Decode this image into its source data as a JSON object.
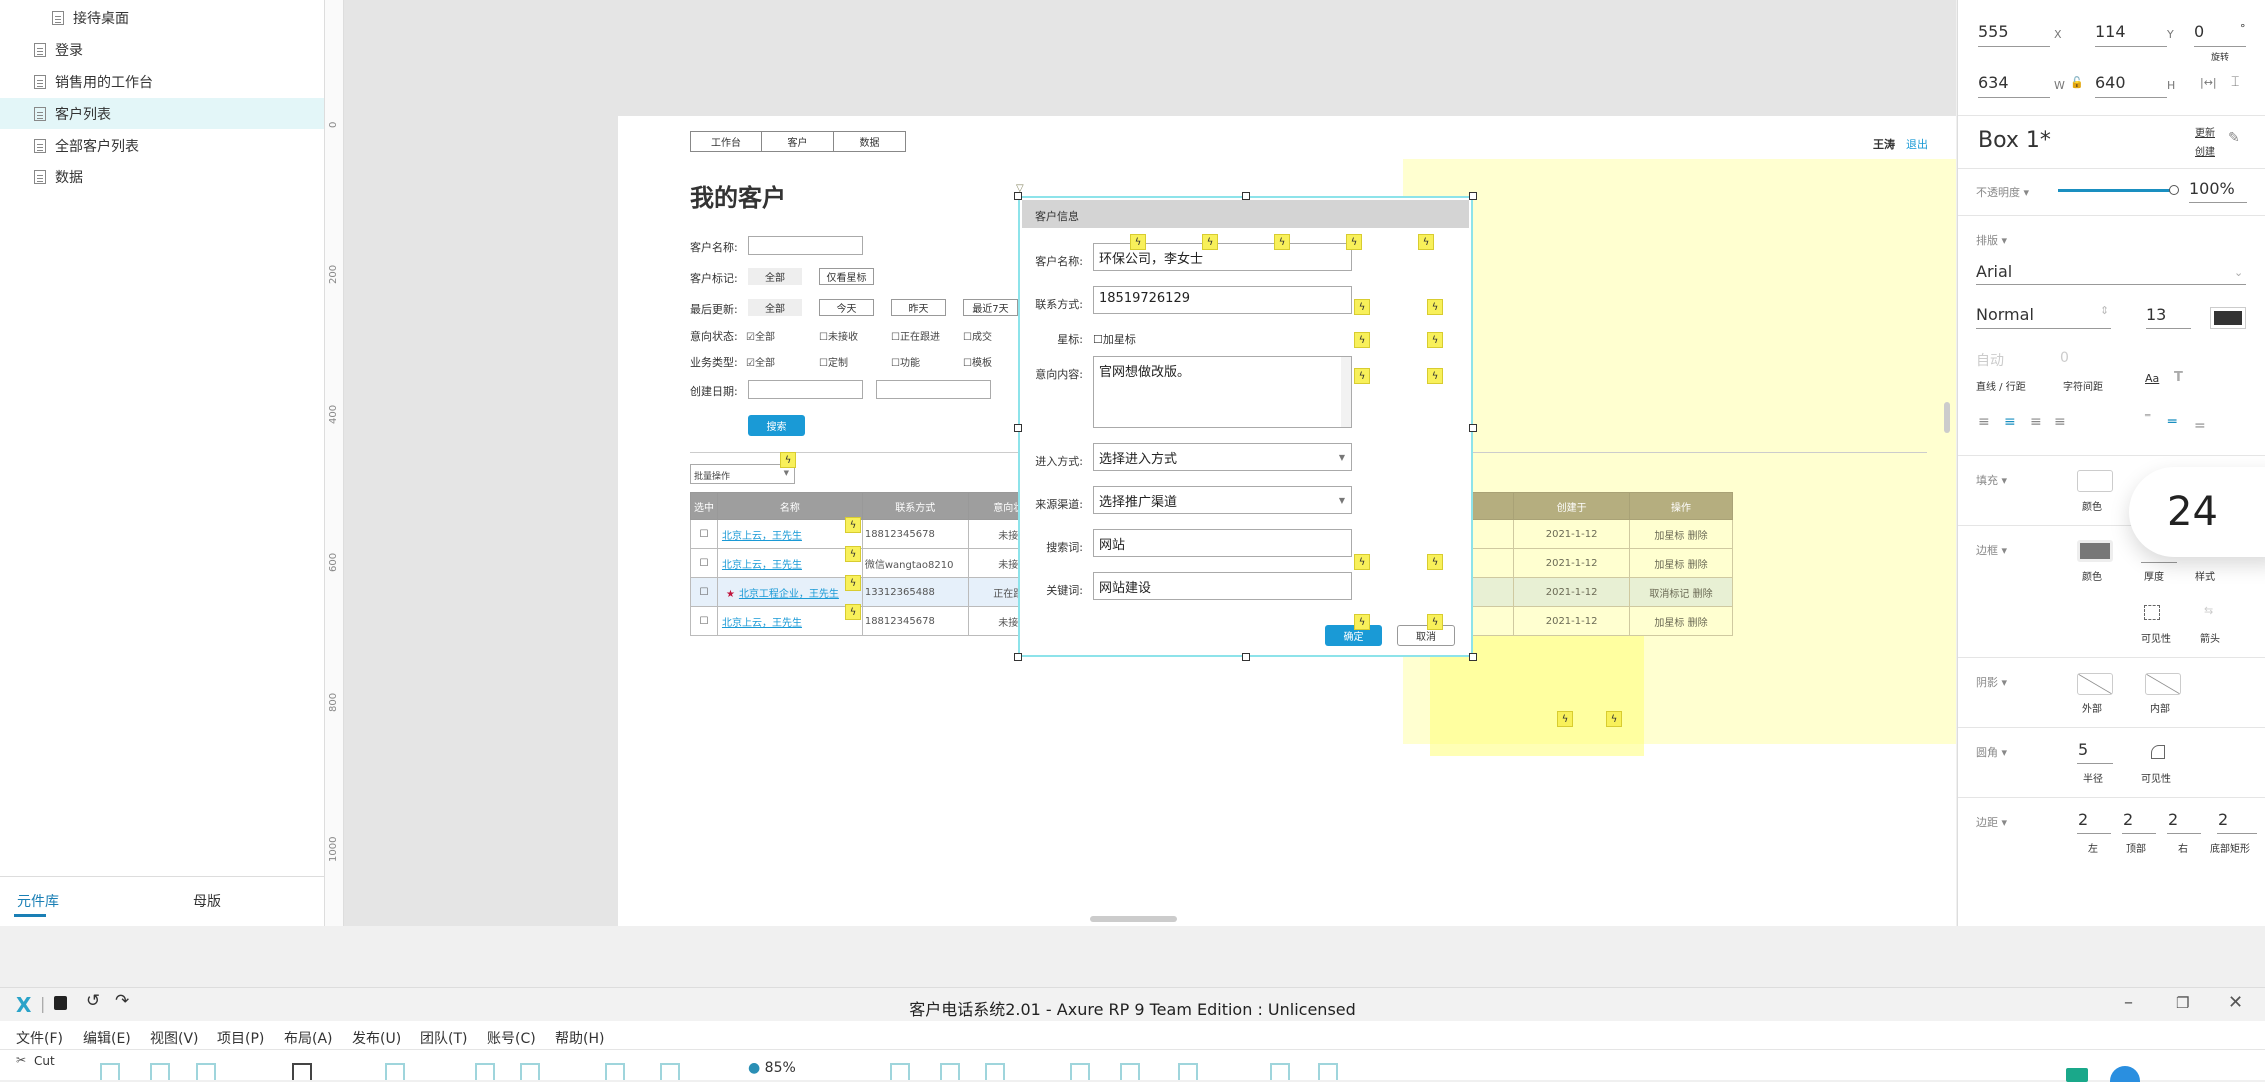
{
  "sidebar": {
    "items": [
      {
        "label": "接待桌面"
      },
      {
        "label": "登录"
      },
      {
        "label": "销售用的工作台"
      },
      {
        "label": "客户列表",
        "active": true
      },
      {
        "label": "全部客户列表"
      },
      {
        "label": "数据"
      }
    ],
    "tabs": [
      {
        "label": "元件库",
        "active": true
      },
      {
        "label": "母版"
      }
    ]
  },
  "ruler": {
    "ticks": [
      "0",
      "200",
      "400",
      "600",
      "800",
      "1000"
    ]
  },
  "proto": {
    "nav": [
      "工作台",
      "客户",
      "数据"
    ],
    "user": "王涛",
    "logout": "退出",
    "title": "我的客户",
    "form": {
      "name_label": "客户名称:",
      "mark_label": "客户标记:",
      "mark_all": "全部",
      "mark_star": "仅看星标",
      "update_label": "最后更新:",
      "update_opts": [
        "全部",
        "今天",
        "昨天",
        "最近7天"
      ],
      "intent_label": "意向状态:",
      "intent_opts": [
        "☑全部",
        "☐未接收",
        "☐正在跟进",
        "☐成交"
      ],
      "biz_label": "业务类型:",
      "biz_opts": [
        "☑全部",
        "☐定制",
        "☐功能",
        "☐模板"
      ],
      "date_label": "创建日期:",
      "search_btn": "搜索"
    },
    "batch": "批量操作",
    "table": {
      "headers": [
        "选中",
        "名称",
        "联系方式",
        "意向状态",
        "创建于",
        "操作"
      ],
      "rows": [
        {
          "name": "北京上云，王先生",
          "contact": "18812345678",
          "status": "未接收",
          "created": "2021-1-12",
          "action1": "加星标",
          "action2": "删除",
          "star": false
        },
        {
          "name": "北京上云，王先生",
          "contact": "微信wangtao8210",
          "status": "未接收",
          "created": "2021-1-12",
          "action1": "加星标",
          "action2": "删除",
          "star": false
        },
        {
          "name": "北京工程企业，王先生",
          "contact": "13312365488",
          "status": "正在跟进",
          "created": "2021-1-12",
          "action1": "取消标记",
          "action2": "删除",
          "star": true
        },
        {
          "name": "北京上云，王先生",
          "contact": "18812345678",
          "status": "未接收",
          "created": "2021-1-12",
          "action1": "加星标",
          "action2": "删除",
          "star": false
        }
      ]
    },
    "dialog": {
      "title": "客户信息",
      "name_label": "客户名称:",
      "name_value": "环保公司，李女士",
      "contact_label": "联系方式:",
      "contact_value": "18519726129",
      "star_label": "星标:",
      "star_opt": "☐加星标",
      "intent_label": "意向内容:",
      "intent_value": "官网想做改版。",
      "entry_label": "进入方式:",
      "entry_value": "选择进入方式",
      "source_label": "来源渠道:",
      "source_value": "选择推广渠道",
      "search_label": "搜索词:",
      "search_value": "网站",
      "keyword_label": "关键词:",
      "keyword_value": "网站建设",
      "ok": "确定",
      "cancel": "取消"
    }
  },
  "inspector": {
    "x": "555",
    "x_label": "X",
    "y": "114",
    "y_label": "Y",
    "rotation": "0",
    "rotation_unit": "°",
    "rotation_label": "旋转",
    "w": "634",
    "w_label": "W",
    "h": "640",
    "h_label": "H",
    "name": "Box 1*",
    "update": "更新",
    "create": "创建",
    "opacity_label": "不透明度 ▾",
    "opacity": "100%",
    "opacity_value": 1.0,
    "typography_label": "排版 ▾",
    "font": "Arial",
    "weight": "Normal",
    "size": "13",
    "text_color": "#333333",
    "line_height": "自动",
    "line_label": "直线 / 行距",
    "spacing": "0",
    "spacing_label": "字符间距",
    "aa": "Aa",
    "fill_label": "填充 ▾",
    "fill_color_label": "颜色",
    "fill_color": "#ffffff",
    "border_label": "边框 ▾",
    "border_color_label": "颜色",
    "border_color": "#777777",
    "thickness_label": "厚度",
    "style_label": "样式",
    "visibility_label": "可见性",
    "arrow_label": "箭头",
    "shadow_label": "阴影 ▾",
    "outer": "外部",
    "inner": "内部",
    "corner_label": "圆角 ▾",
    "radius": "5",
    "radius_label": "半径",
    "corner_vis_label": "可见性",
    "padding_label": "边距 ▾",
    "padding": [
      "2",
      "2",
      "2",
      "2"
    ],
    "padding_labels": [
      "左",
      "顶部",
      "右",
      "底部矩形"
    ],
    "bubble": "24"
  },
  "window": {
    "title": "客户电话系统2.01 - Axure RP 9 Team Edition : Unlicensed",
    "menu": [
      "文件(F)",
      "编辑(E)",
      "视图(V)",
      "项目(P)",
      "布局(A)",
      "发布(U)",
      "团队(T)",
      "账号(C)",
      "帮助(H)"
    ],
    "cut": "Cut",
    "zoom": "85%"
  },
  "colors": {
    "accent": "#1a9ad6",
    "selection": "#8de3ea",
    "sticky": "#ffffaa"
  }
}
